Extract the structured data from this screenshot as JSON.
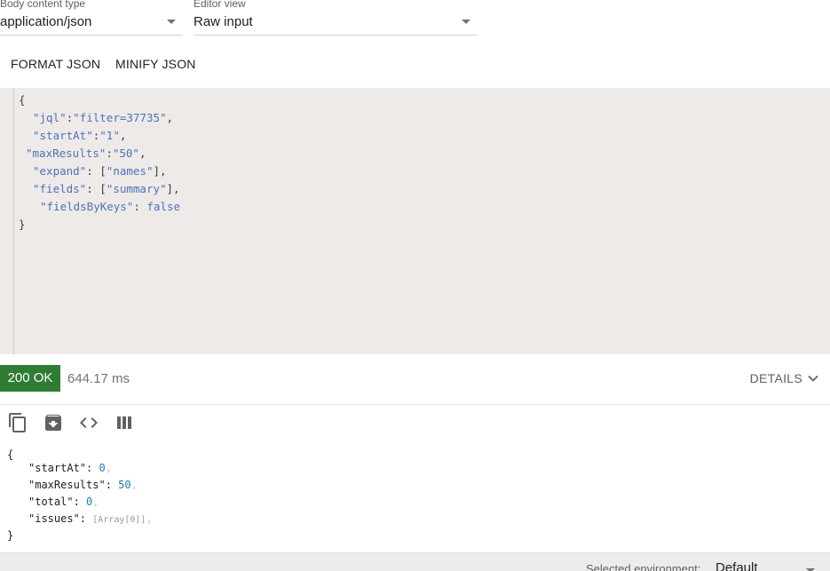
{
  "body_content_type": {
    "label": "Body content type",
    "value": "application/json"
  },
  "editor_view": {
    "label": "Editor view",
    "value": "Raw input"
  },
  "actions": {
    "format": "FORMAT JSON",
    "minify": "MINIFY JSON"
  },
  "request_body": {
    "open": "{",
    "lines": [
      {
        "key": "\"jql\"",
        "sep": ":",
        "value": "\"filter=37735\"",
        "tail": ","
      },
      {
        "key": "\"startAt\"",
        "sep": ":",
        "value": "\"1\"",
        "tail": ","
      },
      {
        "key": "\"maxResults\"",
        "sep": ":",
        "value": "\"50\"",
        "tail": ","
      },
      {
        "key": "\"expand\"",
        "sep": ": [",
        "value": "\"names\"",
        "tail": "],"
      },
      {
        "key": "\"fields\"",
        "sep": ": [",
        "value": "\"summary\"",
        "tail": "],"
      },
      {
        "key": "\"fieldsByKeys\"",
        "sep": ": ",
        "value": "false",
        "tail": ""
      }
    ],
    "close": "}"
  },
  "response": {
    "status": "200 OK",
    "time": "644.17 ms",
    "details_label": "DETAILS",
    "open": "{",
    "lines": [
      {
        "key": "\"startAt\"",
        "sep": ": ",
        "value": "0",
        "tail": ","
      },
      {
        "key": "\"maxResults\"",
        "sep": ": ",
        "value": "50",
        "tail": ","
      },
      {
        "key": "\"total\"",
        "sep": ": ",
        "value": "0",
        "tail": ","
      },
      {
        "key": "\"issues\"",
        "sep": ": ",
        "value": "[Array[0]]",
        "tail": ","
      }
    ],
    "close": "}"
  },
  "toolbar_icons": [
    "copy-icon",
    "archive-icon",
    "code-icon",
    "columns-icon"
  ],
  "footer": {
    "environment_label": "Selected environment:",
    "environment_value": "Default"
  },
  "colors": {
    "status_ok": "#2e7d32",
    "json_key": "#4f72b8",
    "json_number": "#1e7fb5",
    "editor_bg": "#edeae8"
  }
}
